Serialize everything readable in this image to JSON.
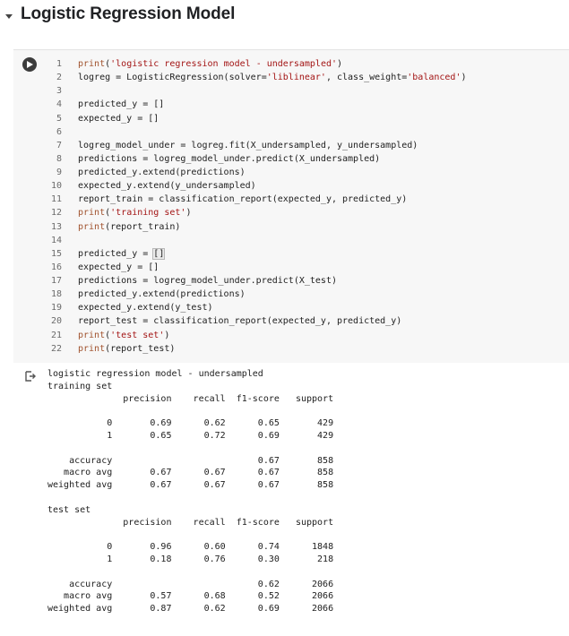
{
  "section": {
    "title": "Logistic Regression Model",
    "toggle_icon": "triangle-down-icon"
  },
  "code_cell": {
    "run_icon": "play-icon",
    "lines": [
      {
        "no": "1",
        "code": "print('logistic regression model - undersampled')"
      },
      {
        "no": "2",
        "code": "logreg = LogisticRegression(solver='liblinear', class_weight='balanced')"
      },
      {
        "no": "3",
        "code": ""
      },
      {
        "no": "4",
        "code": "predicted_y = []"
      },
      {
        "no": "5",
        "code": "expected_y = []"
      },
      {
        "no": "6",
        "code": ""
      },
      {
        "no": "7",
        "code": "logreg_model_under = logreg.fit(X_undersampled, y_undersampled)"
      },
      {
        "no": "8",
        "code": "predictions = logreg_model_under.predict(X_undersampled)"
      },
      {
        "no": "9",
        "code": "predicted_y.extend(predictions)"
      },
      {
        "no": "10",
        "code": "expected_y.extend(y_undersampled)"
      },
      {
        "no": "11",
        "code": "report_train = classification_report(expected_y, predicted_y)"
      },
      {
        "no": "12",
        "code": "print('training set')"
      },
      {
        "no": "13",
        "code": "print(report_train)"
      },
      {
        "no": "14",
        "code": ""
      },
      {
        "no": "15",
        "code": "predicted_y = []"
      },
      {
        "no": "16",
        "code": "expected_y = []"
      },
      {
        "no": "17",
        "code": "predictions = logreg_model_under.predict(X_test)"
      },
      {
        "no": "18",
        "code": "predicted_y.extend(predictions)"
      },
      {
        "no": "19",
        "code": "expected_y.extend(y_test)"
      },
      {
        "no": "20",
        "code": "report_test = classification_report(expected_y, predicted_y)"
      },
      {
        "no": "21",
        "code": "print('test set')"
      },
      {
        "no": "22",
        "code": "print(report_test)"
      }
    ]
  },
  "output": {
    "icon": "output-redirect-icon",
    "text": "logistic regression model - undersampled\ntraining set\n              precision    recall  f1-score   support\n\n           0       0.69      0.62      0.65       429\n           1       0.65      0.72      0.69       429\n\n    accuracy                           0.67       858\n   macro avg       0.67      0.67      0.67       858\nweighted avg       0.67      0.67      0.67       858\n\ntest set\n              precision    recall  f1-score   support\n\n           0       0.96      0.60      0.74      1848\n           1       0.18      0.76      0.30       218\n\n    accuracy                           0.62      2066\n   macro avg       0.57      0.68      0.52      2066\nweighted avg       0.87      0.62      0.69      2066"
  }
}
